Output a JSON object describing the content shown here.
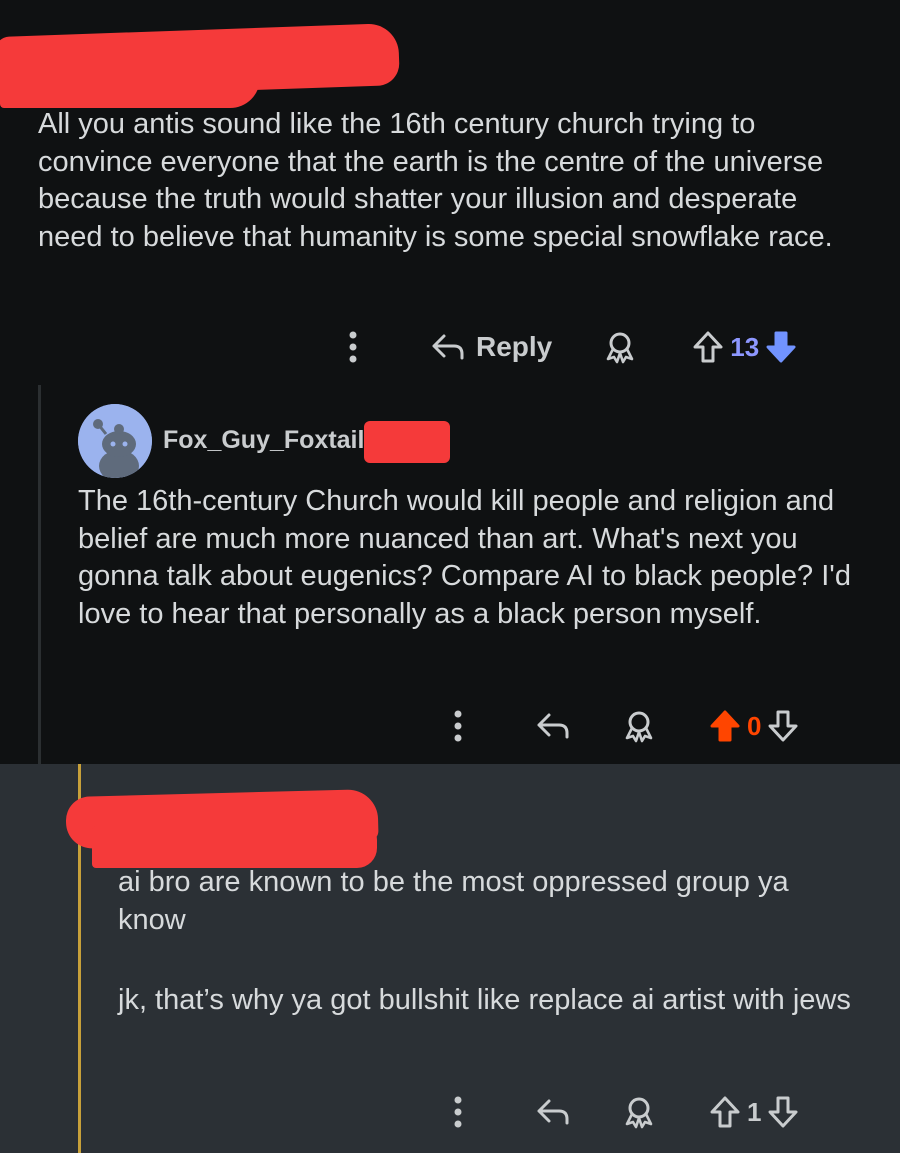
{
  "comments": [
    {
      "body": "All you antis sound like the 16th century church trying to convince everyone that the earth is the centre of the universe because the truth would shatter your illusion and desperate need to believe that humanity is some special snowflake race.",
      "actions": {
        "reply_label": "Reply",
        "score": "13",
        "vote_state": "downvoted"
      }
    },
    {
      "author": "Fox_Guy_Foxtail",
      "body": "The 16th-century Church would kill people and religion and belief are much more nuanced than art. What's next you gonna talk about eugenics? Compare AI to black people? I'd love to hear that personally as a black person myself.",
      "actions": {
        "score": "0",
        "vote_state": "upvoted"
      }
    },
    {
      "paragraphs": [
        "ai bro are known to be the most oppressed group ya know",
        "jk, that’s why ya got bullshit like replace ai artist with jews"
      ],
      "actions": {
        "score": "1",
        "vote_state": "none"
      }
    }
  ],
  "colors": {
    "background": "#0f1112",
    "reply_panel": "#2b3035",
    "upvote_active": "#ff4500",
    "downvote_active": "#7193ff",
    "redaction": "#f53a3a",
    "thread_highlight": "#c7a03a"
  },
  "icons": [
    "more-vertical-icon",
    "reply-arrow-icon",
    "award-icon",
    "upvote-icon",
    "downvote-icon",
    "avatar-icon"
  ]
}
